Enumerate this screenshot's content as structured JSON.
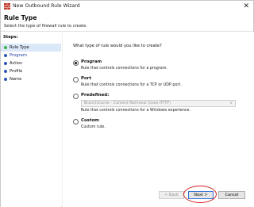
{
  "window": {
    "title": "New Outbound Rule Wizard",
    "close_glyph": "✕"
  },
  "header": {
    "title": "Rule Type",
    "description": "Select the type of firewall rule to create."
  },
  "sidebar": {
    "steps_label": "Steps:",
    "items": [
      {
        "label": "Rule Type",
        "selected": true
      },
      {
        "label": "Program",
        "selected": false
      },
      {
        "label": "Action",
        "selected": false
      },
      {
        "label": "Profile",
        "selected": false
      },
      {
        "label": "Name",
        "selected": false
      }
    ]
  },
  "main": {
    "question": "What type of rule would you like to create?",
    "options": [
      {
        "label": "Program",
        "description": "Rule that controls connections for a program.",
        "checked": true
      },
      {
        "label": "Port",
        "description": "Rule that controls connections for a TCP or UDP port.",
        "checked": false
      },
      {
        "label": "Predefined:",
        "dropdown_value": "BranchCache - Content Retrieval (Uses HTTP)",
        "description": "Rule that controls connections for a Windows experience.",
        "checked": false
      },
      {
        "label": "Custom",
        "description": "Custom rule.",
        "checked": false
      }
    ]
  },
  "buttons": {
    "back": "< Back",
    "next": "Next >",
    "cancel": "Cancel"
  },
  "colors": {
    "selected_step_bg": "#dbe8f8",
    "current_step_dot": "#3db34a",
    "step_dot": "#2a57b5",
    "highlight": "#d11f1f"
  },
  "icons": {
    "app": "firewall-wall-icon",
    "close": "close-icon",
    "dropdown": "chevron-down-icon"
  }
}
